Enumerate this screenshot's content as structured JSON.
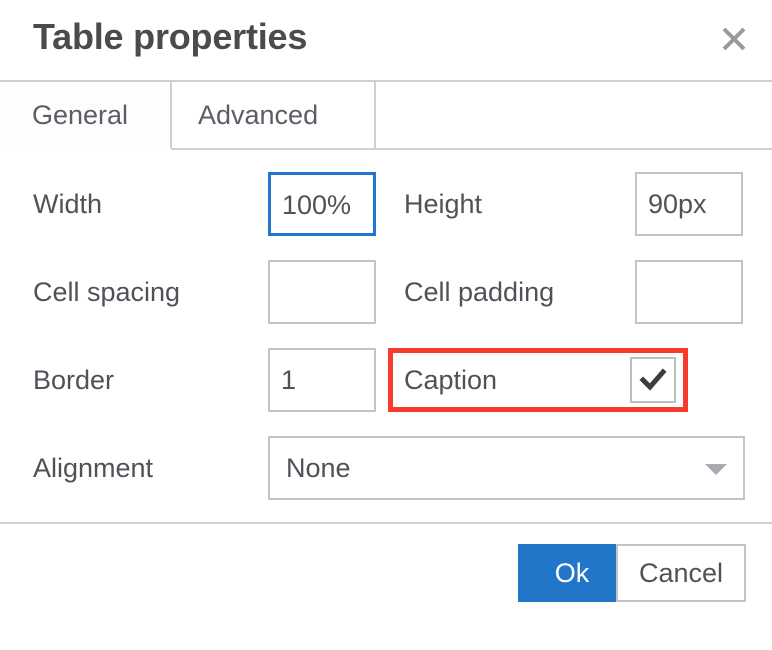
{
  "dialog": {
    "title": "Table properties",
    "close_icon": "close-icon"
  },
  "tabs": [
    {
      "label": "General",
      "active": true
    },
    {
      "label": "Advanced",
      "active": false
    }
  ],
  "form": {
    "width": {
      "label": "Width",
      "value": "100%",
      "placeholder": "",
      "focused": true
    },
    "height": {
      "label": "Height",
      "value": "90px",
      "placeholder": "",
      "focused": false
    },
    "cell_spacing": {
      "label": "Cell spacing",
      "value": "",
      "placeholder": "",
      "focused": false
    },
    "cell_padding": {
      "label": "Cell padding",
      "value": "",
      "placeholder": "",
      "focused": false
    },
    "border": {
      "label": "Border",
      "value": "1",
      "placeholder": "",
      "focused": false
    },
    "caption": {
      "label": "Caption",
      "checked": true,
      "check_icon": "check-icon",
      "highlighted": true
    },
    "alignment": {
      "label": "Alignment",
      "value": "None",
      "arrow_icon": "chevron-down-icon"
    }
  },
  "footer": {
    "ok_label": "Ok",
    "cancel_label": "Cancel"
  },
  "colors": {
    "accent": "#2276c9",
    "focus_border": "#2276d2",
    "highlight": "#f73b2d",
    "border": "#c4c4c4",
    "text": "#4f5358"
  }
}
